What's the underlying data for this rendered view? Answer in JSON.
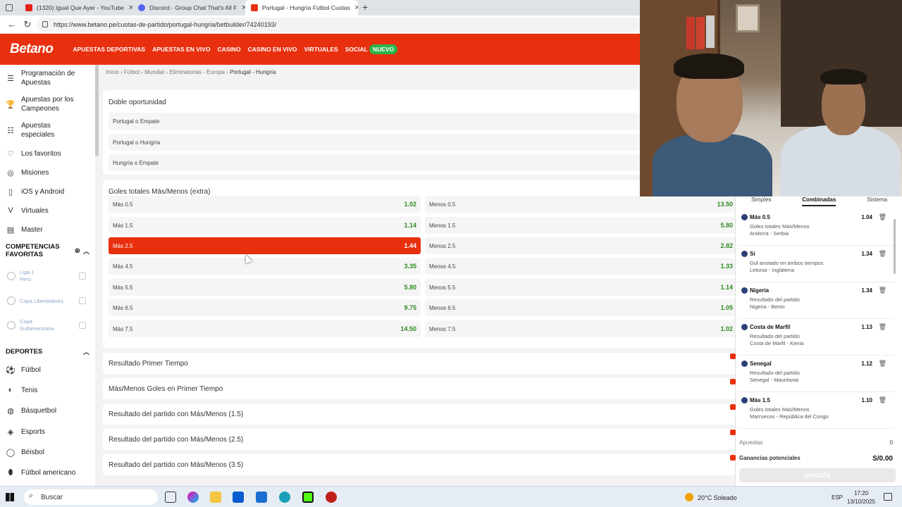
{
  "browser": {
    "tabs": [
      {
        "title": "(1320) Igual Que Ayer - YouTube",
        "icon": "youtube-icon",
        "color": "#e62117"
      },
      {
        "title": "Discord - Group Chat That's All F",
        "icon": "discord-icon",
        "color": "#5865f2"
      },
      {
        "title": "Portugal - Hungría Fútbol Cuotas",
        "icon": "betano-icon",
        "color": "#e8300f"
      }
    ],
    "url": "https://www.betano.pe/cuotas-de-partido/portugal-hungria/betbuilder/74240193/"
  },
  "header": {
    "logo": "Betano",
    "nav": [
      "APUESTAS DEPORTIVAS",
      "APUESTAS EN VIVO",
      "CASINO",
      "CASINO EN VIVO",
      "VIRTUALES",
      "SOCIAL"
    ],
    "new_badge": "NUEVO"
  },
  "sidebar": {
    "items": [
      {
        "label": "Programación de Apuestas",
        "icon": "schedule-icon"
      },
      {
        "label": "Apuestas por los Campeones",
        "icon": "trophy-icon"
      },
      {
        "label": "Apuestas especiales",
        "icon": "special-bets-icon"
      },
      {
        "label": "Los favoritos",
        "icon": "favorites-icon"
      },
      {
        "label": "Misiones",
        "icon": "missions-icon"
      },
      {
        "label": "iOS y Android",
        "icon": "mobile-icon"
      },
      {
        "label": "Virtuales",
        "icon": "virtuals-icon"
      },
      {
        "label": "Master",
        "icon": "master-icon"
      }
    ],
    "favorites_title": "COMPETENCIAS FAVORITAS",
    "favorites": [
      {
        "line1": "Liga 1",
        "line2": "Perú"
      },
      {
        "line1": "Copa Libertadores",
        "line2": ""
      },
      {
        "line1": "Copa",
        "line2": "Sudamericana"
      }
    ],
    "sports_title": "DEPORTES",
    "sports": [
      {
        "label": "Fútbol",
        "icon": "soccer-icon"
      },
      {
        "label": "Tenis",
        "icon": "tennis-icon"
      },
      {
        "label": "Básquetbol",
        "icon": "basketball-icon"
      },
      {
        "label": "Esports",
        "icon": "esports-icon"
      },
      {
        "label": "Béisbol",
        "icon": "baseball-icon"
      },
      {
        "label": "Fútbol americano",
        "icon": "american-football-icon"
      }
    ]
  },
  "breadcrumb": {
    "parts": [
      "Inicio",
      "Fútbol",
      "Mundial",
      "Eliminatorias - Europa"
    ],
    "current": "Portugal - Hungría"
  },
  "double_chance": {
    "title": "Doble oportunidad",
    "options": [
      "Portugal o Empate",
      "Portugal o Hungría",
      "Hungría o Empate"
    ]
  },
  "totals": {
    "title": "Goles totales Más/Menos (extra)",
    "over": [
      {
        "label": "Más 0.5",
        "odd": "1.02"
      },
      {
        "label": "Más 1.5",
        "odd": "1.14"
      },
      {
        "label": "Más 2.5",
        "odd": "1.44"
      },
      {
        "label": "Más 4.5",
        "odd": "3.35"
      },
      {
        "label": "Más 5.5",
        "odd": "5.80"
      },
      {
        "label": "Más 6.5",
        "odd": "9.75"
      },
      {
        "label": "Más 7.5",
        "odd": "14.50"
      }
    ],
    "under": [
      {
        "label": "Menos 0.5",
        "odd": "13.50"
      },
      {
        "label": "Menos 1.5",
        "odd": "5.80"
      },
      {
        "label": "Menos 2.5",
        "odd": "2.82"
      },
      {
        "label": "Menos 4.5",
        "odd": "1.33"
      },
      {
        "label": "Menos 5.5",
        "odd": "1.14"
      },
      {
        "label": "Menos 6.5",
        "odd": "1.05"
      },
      {
        "label": "Menos 7.5",
        "odd": "1.02"
      }
    ],
    "selected_index": 2
  },
  "markets": [
    "Resultado Primer Tiempo",
    "Más/Menos Goles en Primer Tiempo",
    "Resultado del partido con Más/Menos (1.5)",
    "Resultado del partido con Más/Menos (2.5)",
    "Resultado del partido con Más/Menos (3.5)"
  ],
  "betslip": {
    "tabs": [
      "Simples",
      "Combinadas",
      "Sistema"
    ],
    "active_tab": "Combinadas",
    "selections": [
      {
        "selection": "Más 0.5",
        "market": "Goles totales Más/Menos",
        "event": "Andorra - Serbia",
        "odd": "1.04"
      },
      {
        "selection": "Sí",
        "market": "Gol anotado en ambos tiempos",
        "event": "Letonia - Inglaterra",
        "odd": "1.34"
      },
      {
        "selection": "Nigeria",
        "market": "Resultado del partido",
        "event": "Nigeria - Benin",
        "odd": "1.34"
      },
      {
        "selection": "Costa de Marfil",
        "market": "Resultado del partido",
        "event": "Costa de Marfil - Kenia",
        "odd": "1.13"
      },
      {
        "selection": "Senegal",
        "market": "Resultado del partido",
        "event": "Senegal - Mauritania",
        "odd": "1.12"
      },
      {
        "selection": "Más 1.5",
        "market": "Goles totales Más/Menos",
        "event": "Marruecos - República del Congo",
        "odd": "1.10"
      }
    ],
    "stake_label": "Apuestas",
    "stake_value": "0",
    "winnings_label": "Ganancias potenciales",
    "winnings_value": "S/0.00",
    "submit_label": "APUESTA"
  },
  "taskbar": {
    "search": "Buscar",
    "weather": "20°C  Soleado",
    "lang": "ESP",
    "time": "17:20",
    "date": "13/10/2025"
  }
}
